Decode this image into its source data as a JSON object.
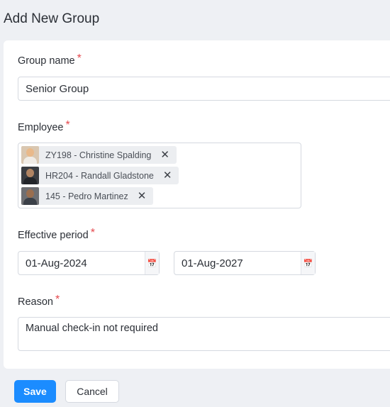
{
  "page": {
    "title": "Add New Group"
  },
  "form": {
    "group_name": {
      "label": "Group name",
      "required_mark": "*",
      "value": "Senior Group"
    },
    "employee": {
      "label": "Employee",
      "required_mark": "*",
      "chips": [
        {
          "label": "ZY198 - Christine Spalding",
          "remove": "✕"
        },
        {
          "label": "HR204 - Randall Gladstone",
          "remove": "✕"
        },
        {
          "label": "145 - Pedro Martinez",
          "remove": "✕"
        }
      ]
    },
    "effective_period": {
      "label": "Effective period",
      "required_mark": "*",
      "start": "01-Aug-2024",
      "end": "01-Aug-2027"
    },
    "reason": {
      "label": "Reason",
      "required_mark": "*",
      "value": "Manual check-in not required"
    }
  },
  "actions": {
    "save_label": "Save",
    "cancel_label": "Cancel"
  },
  "colors": {
    "primary": "#1b8cff",
    "required": "#e5484d",
    "background": "#eef0f4"
  }
}
